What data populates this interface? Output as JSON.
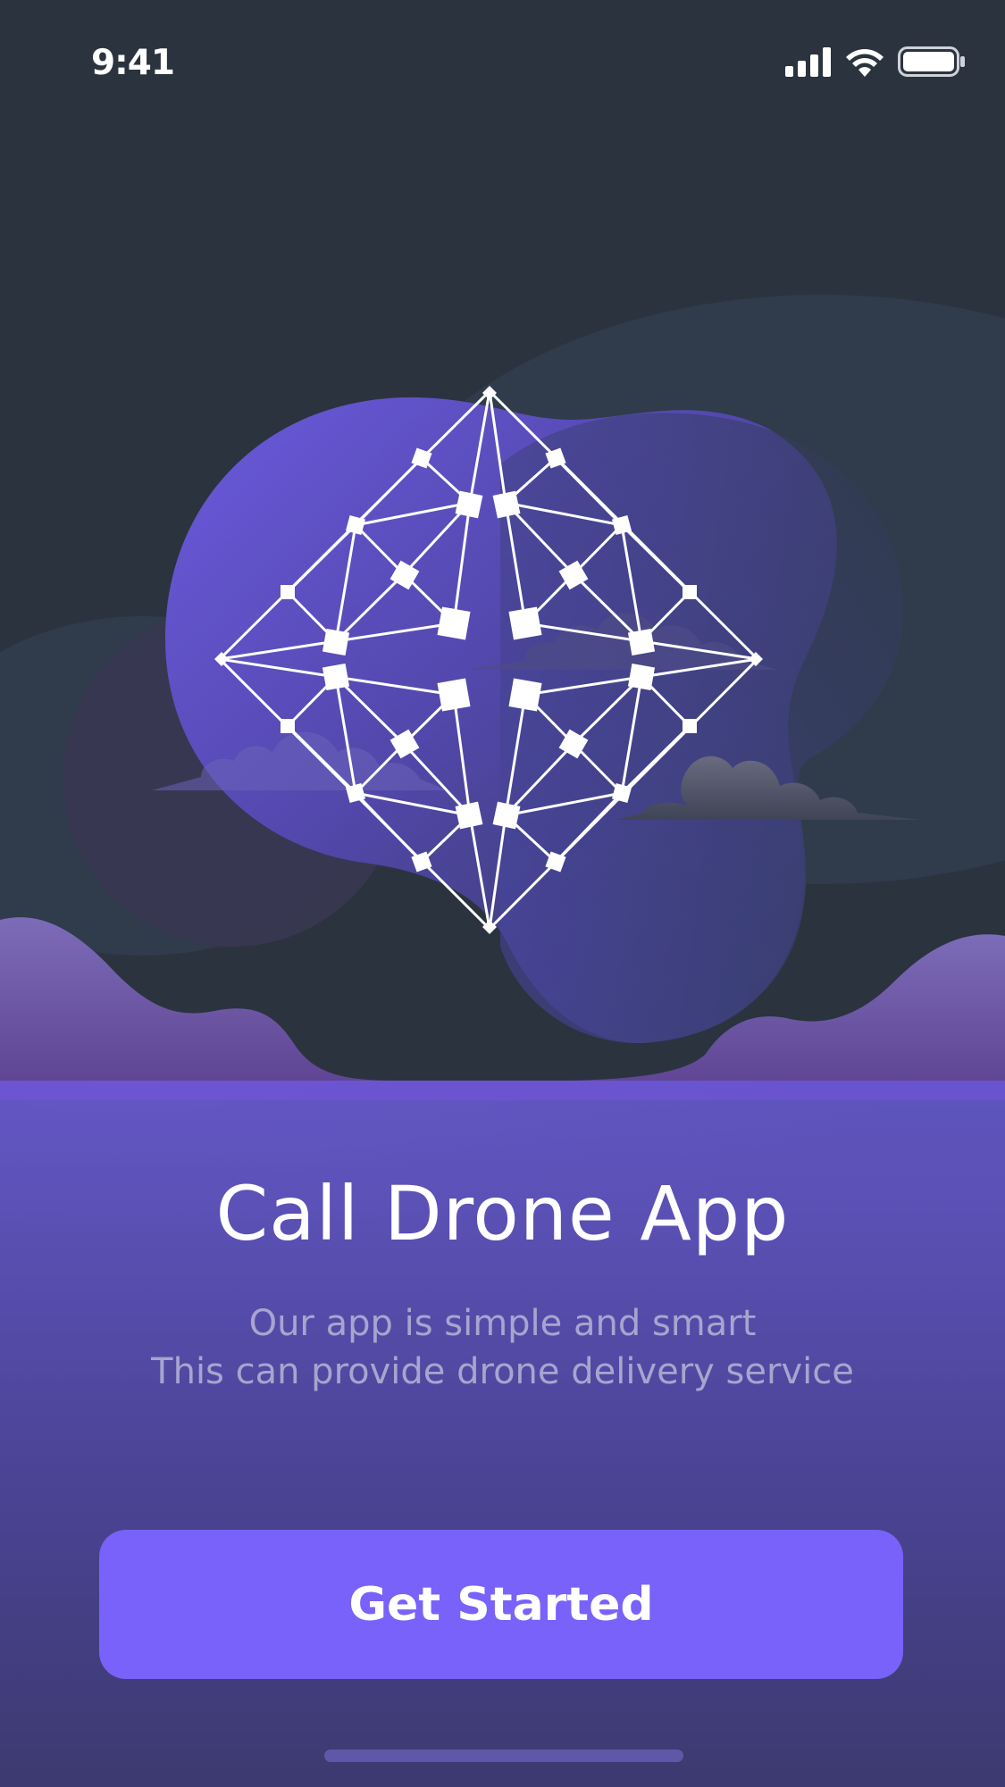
{
  "status_bar": {
    "time": "9:41",
    "icons": [
      "cellular-signal-icon",
      "wifi-icon",
      "battery-icon"
    ]
  },
  "hero": {
    "illustration": "drone-network-diamond",
    "elements": [
      "background-blobs",
      "clouds",
      "hills",
      "drone-mesh-icon"
    ]
  },
  "onboarding": {
    "title": "Call Drone App",
    "subtitle_line1": "Our app is simple and smart",
    "subtitle_line2": "This can provide drone delivery service",
    "cta_label": "Get Started"
  },
  "colors": {
    "background_dark": "#2b333f",
    "accent_purple": "#7862fa",
    "panel_purple": "#5e55bd",
    "subtitle_text": "#a9a4cf",
    "title_text": "#ffffff"
  }
}
